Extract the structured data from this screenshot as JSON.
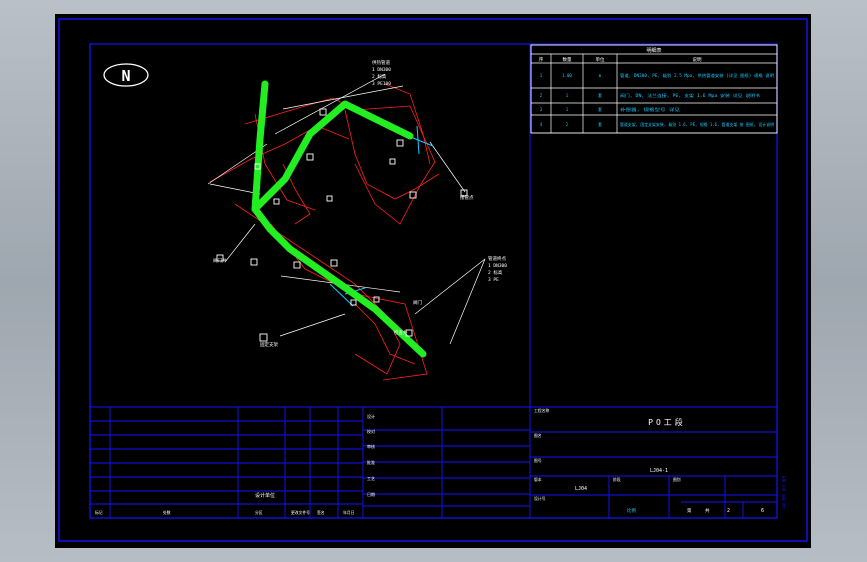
{
  "north": {
    "label": "N"
  },
  "colors": {
    "frame": "#1414ff",
    "pipe": "#22ee22",
    "outline": "#ff2020",
    "annotation": "#ffffff",
    "table_text": "#1ec8ff"
  },
  "table": {
    "title": "明细表",
    "headers": [
      "序",
      "数量",
      "单位",
      "说明"
    ],
    "rows": [
      {
        "no": "1",
        "qty": "1.00",
        "unit": "m",
        "desc": "管道, DN300, PE, 级别 2.5 Mpa, 供热管道安装 (详见 图纸) 规格 说明"
      },
      {
        "no": "2",
        "qty": "1",
        "unit": "套",
        "desc": "阀门, DN, 法兰连接, PE, 支架 1.6 Mpa 安装 详见 说明书"
      },
      {
        "no": "3",
        "qty": "1",
        "unit": "套",
        "desc": "补偿器, 规格型号 详见"
      },
      {
        "no": "4",
        "qty": "2",
        "unit": "套",
        "desc": "管道支架, 固定支架安装, 级别 1.6, PE, 规格 1.6, 管道支架 按 图纸, 设计说明"
      }
    ]
  },
  "callouts": {
    "top": [
      "供热管道",
      "1 DN300",
      "2 标高",
      "3 PE100"
    ],
    "right": [
      "管道终点",
      "1 DN300",
      "2 标高",
      "3 PE"
    ],
    "labels": [
      "阀门井",
      "固定支架",
      "接管点",
      "阀门",
      "检查井"
    ]
  },
  "title_block": {
    "project_title": "PO工段",
    "drawing_no": "LJ04-1",
    "sheet_code": "LJ04",
    "scale_label": "比例",
    "sheet_label": "第",
    "sheet_no": "2",
    "total_label": "共",
    "total_no": "6",
    "left_stamp": "设计单位",
    "mid_labels": [
      "设计",
      "校对",
      "审核",
      "批准",
      "工艺",
      "日期"
    ],
    "bottom_labels": [
      "标记",
      "处数",
      "分区",
      "更改文件号",
      "签名",
      "年月日"
    ],
    "box_labels": [
      "工程名称",
      "图名",
      "图号",
      "版本",
      "阶段",
      "图别",
      "设计号"
    ],
    "vertical_note": "CAD 图纸 设计 图号"
  }
}
